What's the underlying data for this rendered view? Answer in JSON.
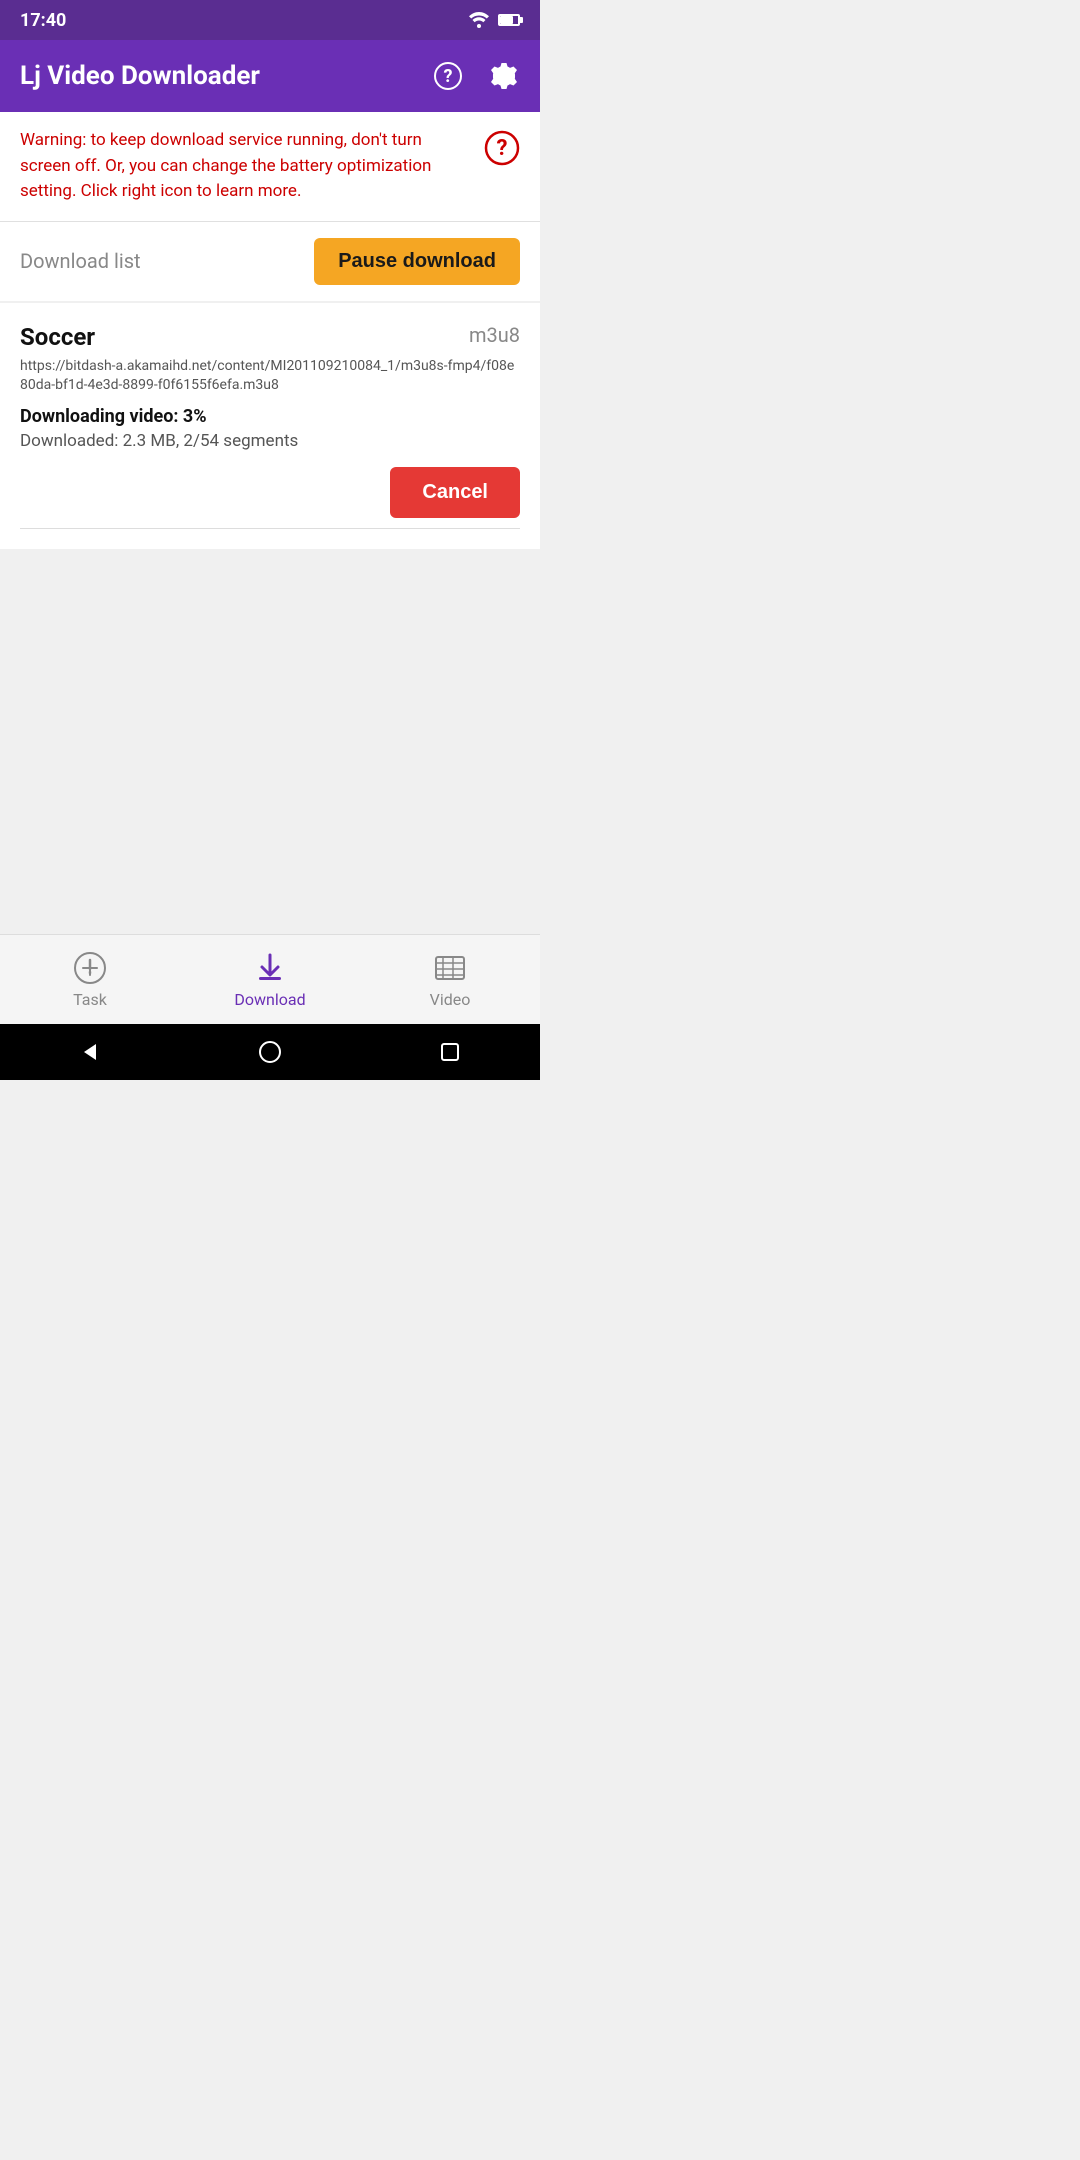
{
  "statusBar": {
    "time": "17:40"
  },
  "appBar": {
    "title": "Lj Video Downloader",
    "helpIcon": "help-circle-icon",
    "settingsIcon": "gear-icon"
  },
  "warning": {
    "text": "Warning: to keep download service running, don't turn screen off. Or, you can change the battery optimization setting. Click right icon to learn more.",
    "icon": "help-circle-icon"
  },
  "downloadList": {
    "sectionTitle": "Download list",
    "pauseButton": "Pause download"
  },
  "downloadItem": {
    "title": "Soccer",
    "format": "m3u8",
    "url": "https://bitdash-a.akamaihd.net/content/MI201109210084_1/m3u8s-fmp4/f08e80da-bf1d-4e3d-8899-f0f6155f6efa.m3u8",
    "statusLabel": "Downloading video: 3%",
    "detailsLabel": "Downloaded: 2.3 MB, 2/54 segments",
    "cancelButton": "Cancel"
  },
  "bottomNav": {
    "items": [
      {
        "id": "task",
        "label": "Task",
        "active": false
      },
      {
        "id": "download",
        "label": "Download",
        "active": true
      },
      {
        "id": "video",
        "label": "Video",
        "active": false
      }
    ]
  },
  "colors": {
    "appBarBg": "#6a2fb5",
    "statusBarBg": "#5a2d91",
    "pauseBtnBg": "#f5a623",
    "cancelBtnBg": "#e53935",
    "activeNavColor": "#6a2fb5",
    "warningTextColor": "#cc0000"
  }
}
